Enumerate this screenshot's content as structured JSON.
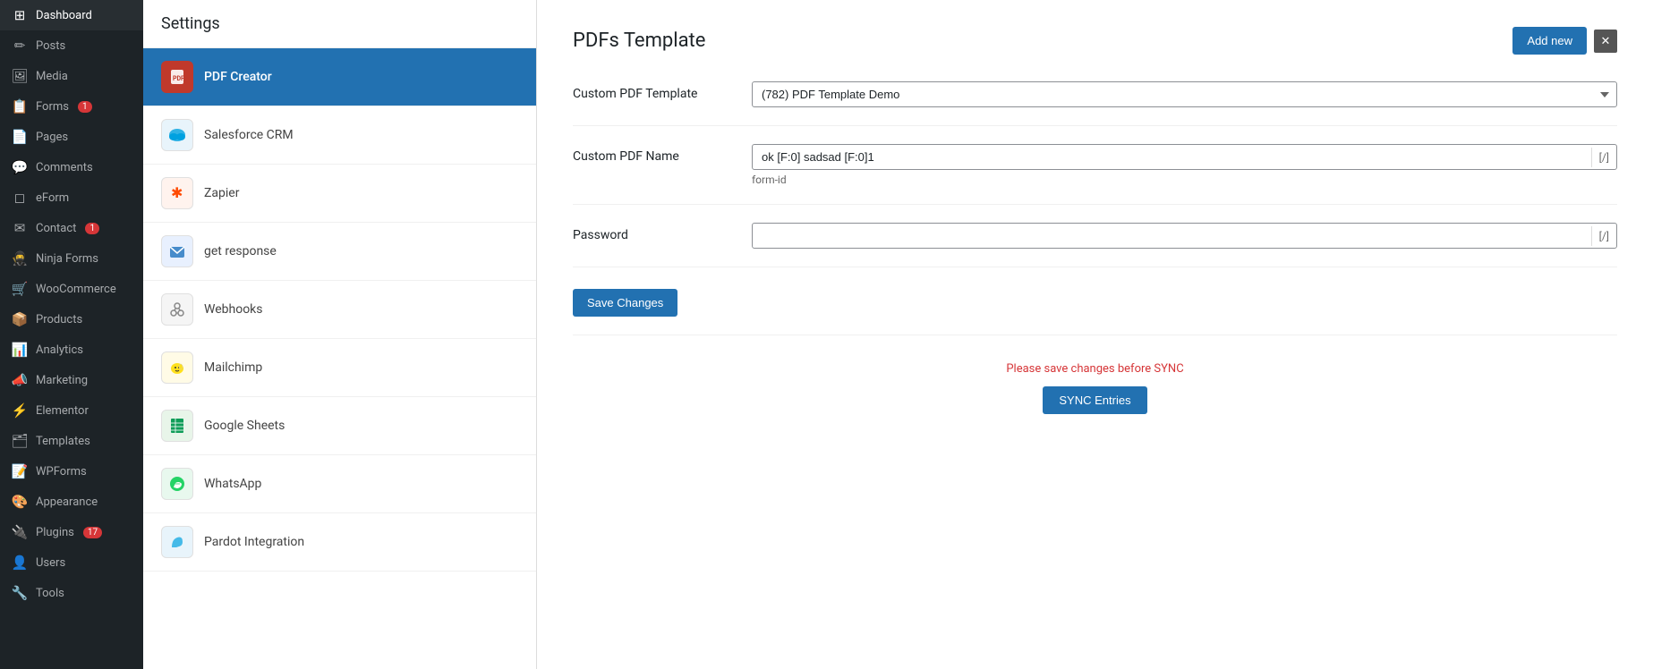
{
  "sidebar": {
    "items": [
      {
        "id": "dashboard",
        "label": "Dashboard",
        "icon": "⊞",
        "badge": null
      },
      {
        "id": "posts",
        "label": "Posts",
        "icon": "📝",
        "badge": null
      },
      {
        "id": "media",
        "label": "Media",
        "icon": "🖼",
        "badge": null
      },
      {
        "id": "forms",
        "label": "Forms",
        "icon": "📋",
        "badge": "1"
      },
      {
        "id": "pages",
        "label": "Pages",
        "icon": "📄",
        "badge": null
      },
      {
        "id": "comments",
        "label": "Comments",
        "icon": "💬",
        "badge": null
      },
      {
        "id": "eform",
        "label": "eForm",
        "icon": "⬜",
        "badge": null
      },
      {
        "id": "contact",
        "label": "Contact",
        "icon": "✉",
        "badge": "1"
      },
      {
        "id": "ninja-forms",
        "label": "Ninja Forms",
        "icon": "🥷",
        "badge": null
      },
      {
        "id": "woocommerce",
        "label": "WooCommerce",
        "icon": "🛒",
        "badge": null
      },
      {
        "id": "products",
        "label": "Products",
        "icon": "📦",
        "badge": null
      },
      {
        "id": "analytics",
        "label": "Analytics",
        "icon": "📊",
        "badge": null
      },
      {
        "id": "marketing",
        "label": "Marketing",
        "icon": "📣",
        "badge": null
      },
      {
        "id": "elementor",
        "label": "Elementor",
        "icon": "⚡",
        "badge": null
      },
      {
        "id": "templates",
        "label": "Templates",
        "icon": "🗂",
        "badge": null
      },
      {
        "id": "wpforms",
        "label": "WPForms",
        "icon": "📝",
        "badge": null
      },
      {
        "id": "appearance",
        "label": "Appearance",
        "icon": "🎨",
        "badge": null
      },
      {
        "id": "plugins",
        "label": "Plugins",
        "icon": "🔌",
        "badge": "17"
      },
      {
        "id": "users",
        "label": "Users",
        "icon": "👤",
        "badge": null
      },
      {
        "id": "tools",
        "label": "Tools",
        "icon": "🔧",
        "badge": null
      }
    ]
  },
  "settings": {
    "header": "Settings",
    "items": [
      {
        "id": "pdf-creator",
        "label": "PDF Creator",
        "icon": "📄",
        "icon_color": "icon-pdf",
        "active": true
      },
      {
        "id": "salesforce",
        "label": "Salesforce CRM",
        "icon": "☁",
        "icon_color": "icon-sf",
        "active": false
      },
      {
        "id": "zapier",
        "label": "Zapier",
        "icon": "✱",
        "icon_color": "icon-zapier",
        "active": false
      },
      {
        "id": "get-response",
        "label": "get response",
        "icon": "✉",
        "icon_color": "icon-gr",
        "active": false
      },
      {
        "id": "webhooks",
        "label": "Webhooks",
        "icon": "🔗",
        "icon_color": "icon-webhook",
        "active": false
      },
      {
        "id": "mailchimp",
        "label": "Mailchimp",
        "icon": "🐒",
        "icon_color": "icon-mc",
        "active": false
      },
      {
        "id": "google-sheets",
        "label": "Google Sheets",
        "icon": "📊",
        "icon_color": "icon-gs",
        "active": false
      },
      {
        "id": "whatsapp",
        "label": "WhatsApp",
        "icon": "📱",
        "icon_color": "icon-wa",
        "active": false
      },
      {
        "id": "pardot",
        "label": "Pardot Integration",
        "icon": "☁",
        "icon_color": "icon-pardot",
        "active": false
      }
    ]
  },
  "main": {
    "title": "PDFs Template",
    "add_new_button": "Add new",
    "close_button": "✕",
    "form": {
      "custom_pdf_template_label": "Custom PDF Template",
      "custom_pdf_template_value": "(782) PDF Template Demo",
      "custom_pdf_template_options": [
        "(782) PDF Template Demo"
      ],
      "custom_pdf_name_label": "Custom PDF Name",
      "custom_pdf_name_value": "ok [F:0] sadsad [F:0]1",
      "custom_pdf_name_tag": "[/]",
      "custom_pdf_name_helper": "form-id",
      "password_label": "Password",
      "password_value": "",
      "password_tag": "[/]"
    },
    "save_changes_button": "Save Changes",
    "sync_note": "Please save changes before SYNC",
    "sync_button": "SYNC Entries"
  }
}
